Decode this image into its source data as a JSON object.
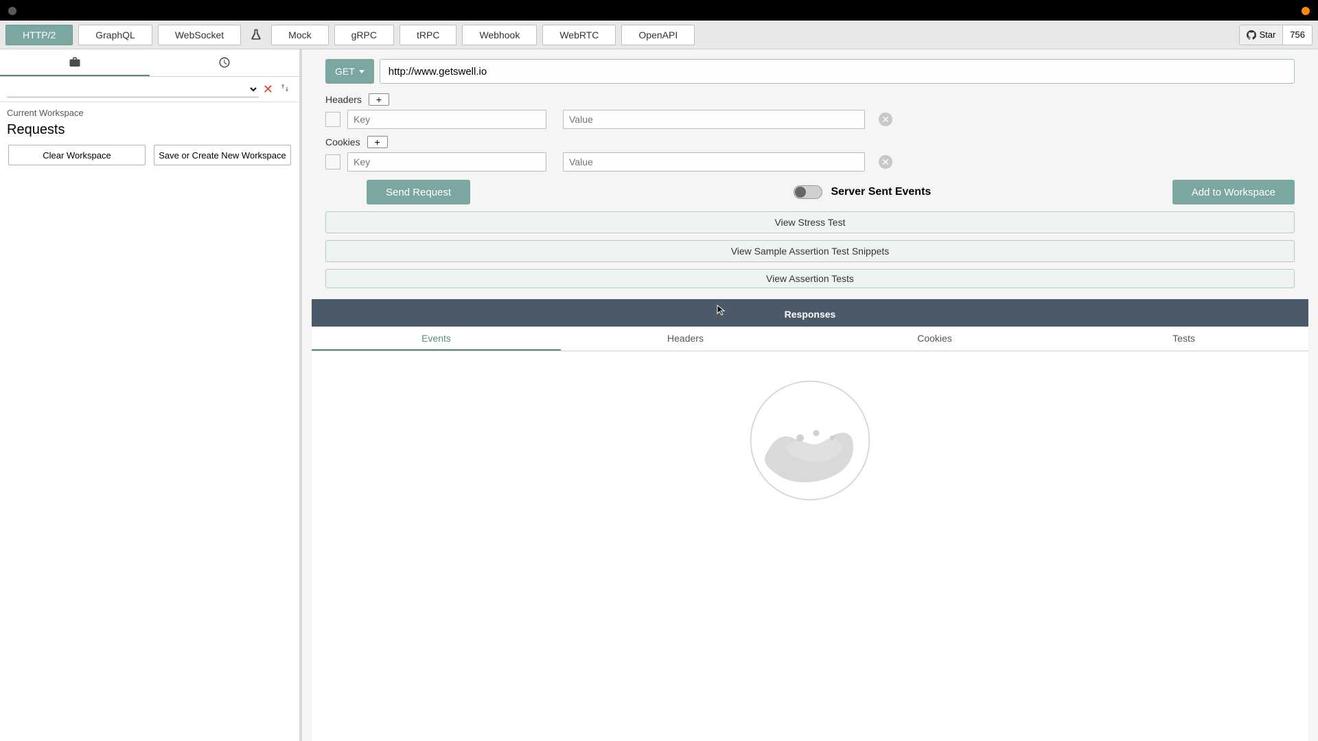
{
  "nav": {
    "tabs": [
      "HTTP/2",
      "GraphQL",
      "WebSocket",
      "Mock",
      "gRPC",
      "tRPC",
      "Webhook",
      "WebRTC",
      "OpenAPI"
    ],
    "active_index": 0,
    "github": {
      "star_label": "Star",
      "count": "756"
    }
  },
  "sidebar": {
    "workspace_label": "Current Workspace",
    "requests_title": "Requests",
    "clear_btn": "Clear Workspace",
    "save_btn": "Save or Create New Workspace"
  },
  "composer": {
    "method": "GET",
    "url_value": "http://www.getswell.io",
    "headers_label": "Headers",
    "cookies_label": "Cookies",
    "key_placeholder": "Key",
    "value_placeholder": "Value",
    "send_btn": "Send Request",
    "sse_label": "Server Sent Events",
    "add_btn": "Add to Workspace",
    "view_stress": "View Stress Test",
    "view_snippets": "View Sample Assertion Test Snippets",
    "view_assert": "View Assertion Tests"
  },
  "responses": {
    "title": "Responses",
    "tabs": [
      "Events",
      "Headers",
      "Cookies",
      "Tests"
    ],
    "active_index": 0
  }
}
